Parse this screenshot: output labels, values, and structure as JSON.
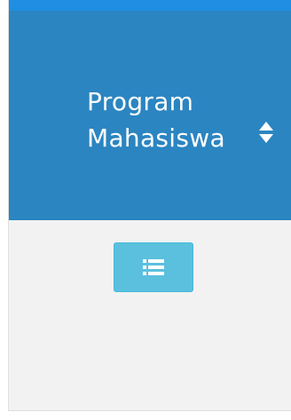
{
  "table": {
    "column_header": {
      "label": "Program Mahasiswa",
      "sort_icon": "sort-icon"
    },
    "row": {
      "action_icon": "list-icon"
    }
  },
  "colors": {
    "top_strip": "#1f8ee3",
    "header_background": "#2b85c1",
    "header_text": "#ffffff",
    "cell_background": "#f2f2f2",
    "button_background": "#5bc0de",
    "button_icon": "#ffffff"
  }
}
